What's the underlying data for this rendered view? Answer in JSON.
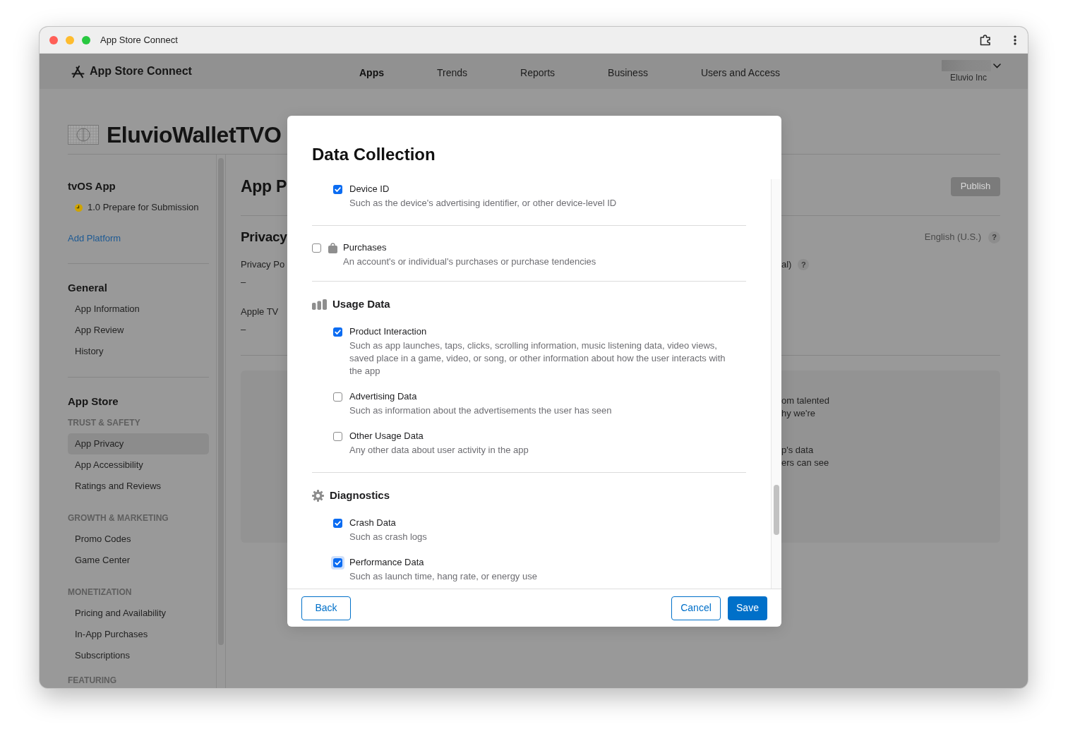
{
  "window": {
    "title": "App Store Connect"
  },
  "header": {
    "logo": "App Store Connect",
    "nav": [
      {
        "label": "Apps",
        "selected": true
      },
      {
        "label": "Trends",
        "selected": false
      },
      {
        "label": "Reports",
        "selected": false
      },
      {
        "label": "Business",
        "selected": false
      },
      {
        "label": "Users and Access",
        "selected": false
      }
    ],
    "account": {
      "team": "Eluvio Inc"
    }
  },
  "app": {
    "name": "EluvioWalletTVO"
  },
  "sidebar": {
    "platform": "tvOS App",
    "version_status": "1.0 Prepare for Submission",
    "add_platform": "Add Platform",
    "sections": [
      {
        "title": "General",
        "groups": [
          {
            "items": [
              {
                "label": "App Information",
                "selected": false
              },
              {
                "label": "App Review",
                "selected": false
              },
              {
                "label": "History",
                "selected": false
              }
            ]
          }
        ]
      },
      {
        "title": "App Store",
        "groups": [
          {
            "heading": "TRUST & SAFETY",
            "items": [
              {
                "label": "App Privacy",
                "selected": true
              },
              {
                "label": "App Accessibility",
                "selected": false
              },
              {
                "label": "Ratings and Reviews",
                "selected": false
              }
            ]
          },
          {
            "heading": "GROWTH & MARKETING",
            "items": [
              {
                "label": "Promo Codes",
                "selected": false
              },
              {
                "label": "Game Center",
                "selected": false
              }
            ]
          },
          {
            "heading": "MONETIZATION",
            "items": [
              {
                "label": "Pricing and Availability",
                "selected": false
              },
              {
                "label": "In-App Purchases",
                "selected": false
              },
              {
                "label": "Subscriptions",
                "selected": false
              }
            ]
          },
          {
            "heading": "FEATURING"
          }
        ]
      }
    ]
  },
  "main": {
    "title": "App P",
    "publish": {
      "label": "Publish",
      "disabled": true
    },
    "section_title": "Privacy",
    "language": {
      "label": "English (U.S.)",
      "help": "?"
    },
    "fields": [
      {
        "label": "Privacy Po",
        "value": "–",
        "column_2": {
          "label": "al)",
          "help": "?"
        }
      },
      {
        "label": "Apple TV",
        "value": "–"
      }
    ],
    "card_texts": [
      "om talented\nhy we're",
      "p's data\ners can see"
    ]
  },
  "modal": {
    "title": "Data Collection",
    "sections": [
      {
        "kind": "list",
        "items": [
          {
            "label": "Device ID",
            "description": "Such as the device's advertising identifier, or other device-level ID",
            "checked": true,
            "focused": false
          }
        ]
      },
      {
        "kind": "single",
        "label": "Purchases",
        "description": "An account's or individual's purchases or purchase tendencies",
        "checked": false
      },
      {
        "kind": "group",
        "title": "Usage Data",
        "items": [
          {
            "label": "Product Interaction",
            "description": "Such as app launches, taps, clicks, scrolling information, music listening data, video views, saved place in a game, video, or song, or other information about how the user interacts with the app",
            "checked": true,
            "focused": false
          },
          {
            "label": "Advertising Data",
            "description": "Such as information about the advertisements the user has seen",
            "checked": false,
            "focused": false
          },
          {
            "label": "Other Usage Data",
            "description": "Any other data about user activity in the app",
            "checked": false,
            "focused": false
          }
        ]
      },
      {
        "kind": "group",
        "title": "Diagnostics",
        "items": [
          {
            "label": "Crash Data",
            "description": "Such as crash logs",
            "checked": true,
            "focused": false
          },
          {
            "label": "Performance Data",
            "description": "Such as launch time, hang rate, or energy use",
            "checked": true,
            "focused": true
          }
        ]
      }
    ],
    "buttons": {
      "back": "Back",
      "cancel": "Cancel",
      "save": "Save"
    }
  }
}
